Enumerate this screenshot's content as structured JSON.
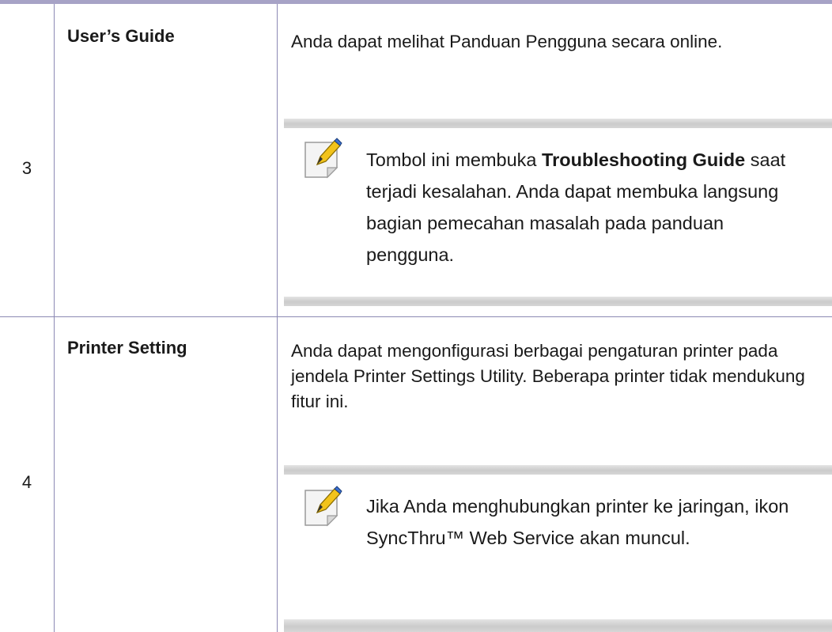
{
  "rows": [
    {
      "number": "3",
      "name": "User’s Guide",
      "description": "Anda dapat melihat Panduan Pengguna secara online.",
      "note": {
        "icon": "note-pencil-icon",
        "before": "Tombol ini membuka ",
        "bold": "Troubleshooting Guide",
        "after": " saat terjadi kesalahan. Anda dapat membuka langsung bagian pemecahan masalah pada panduan pengguna."
      }
    },
    {
      "number": "4",
      "name": "Printer Setting",
      "description": "Anda dapat mengonfigurasi berbagai pengaturan printer pada jendela Printer Settings Utility. Beberapa printer tidak mendukung fitur ini.",
      "note": {
        "icon": "note-pencil-icon",
        "text": "Jika Anda menghubungkan printer ke jaringan, ikon SyncThru™ Web Service akan muncul."
      }
    }
  ],
  "colors": {
    "rule": "#8c89b4",
    "top_rule": "#a7a3c6",
    "note_bar": "#cbcbcb"
  }
}
